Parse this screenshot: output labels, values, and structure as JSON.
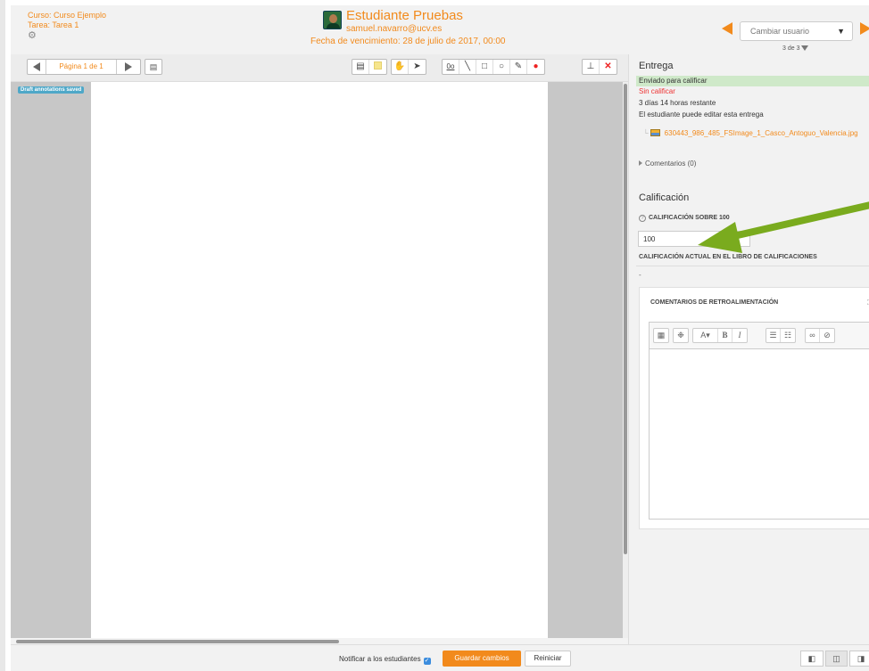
{
  "header": {
    "course": "Curso: Curso Ejemplo",
    "assignment": "Tarea: Tarea 1",
    "student_name": "Estudiante Pruebas",
    "student_email": "samuel.navarro@ucv.es",
    "due_date": "Fecha de vencimiento: 28 de julio de 2017, 00:00",
    "change_user_label": "Cambiar usuario",
    "user_counter": "3 de 3"
  },
  "toolbar": {
    "page_label": "Página 1 de 1"
  },
  "document": {
    "badge": "Draft annotations saved"
  },
  "panel": {
    "submission_title": "Entrega",
    "status": "Enviado para calificar",
    "grading_status": "Sin calificar",
    "time_remaining": "3 días 14 horas restante",
    "editable_note": "El estudiante puede editar esta entrega",
    "file_name": "630443_986_485_FSImage_1_Casco_Antoguo_Valencia.jpg",
    "comments": "Comentarios (0)",
    "grade_title": "Calificación",
    "grade_label": "CALIFICACIÓN SOBRE 100",
    "grade_value": "100",
    "current_grade_label": "CALIFICACIÓN ACTUAL EN EL LIBRO DE CALIFICACIONES",
    "current_grade_value": "-",
    "feedback_title": "COMENTARIOS DE RETROALIMENTACIÓN"
  },
  "footer": {
    "notify_label": "Notificar a los estudiantes",
    "save_label": "Guardar cambios",
    "reset_label": "Reiniciar"
  },
  "colors": {
    "accent": "#f28a1c",
    "status_bg": "#cfe9c9",
    "arrow": "#7aab1e"
  }
}
